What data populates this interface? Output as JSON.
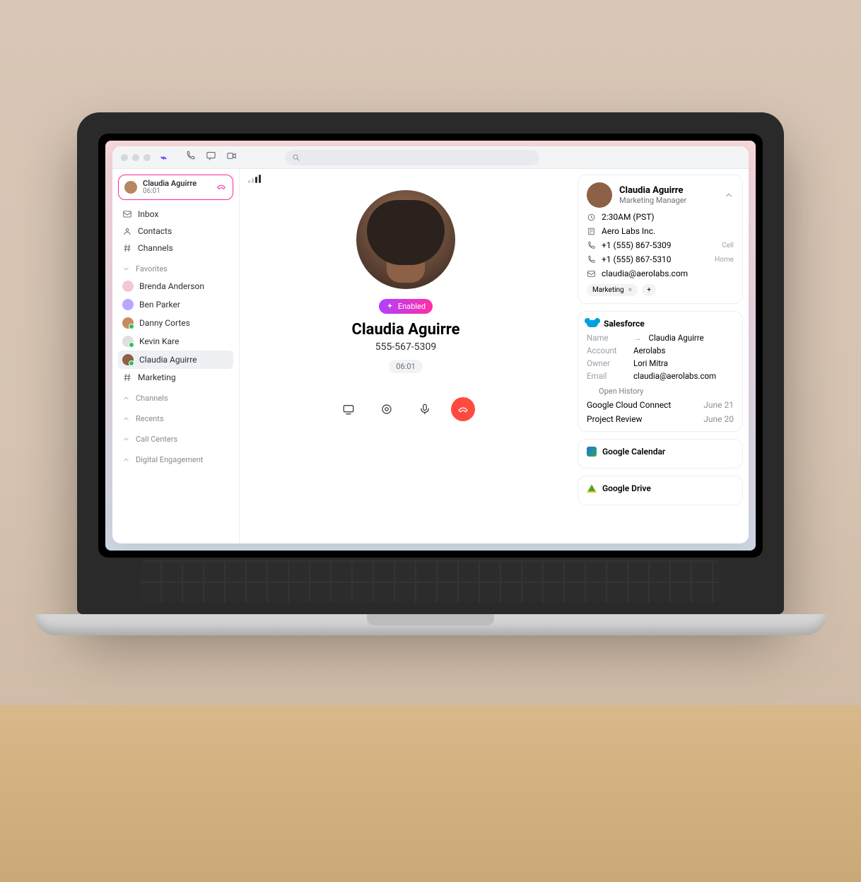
{
  "titlebar": {
    "search_placeholder": ""
  },
  "sidebar": {
    "active_call": {
      "name": "Claudia Aguirre",
      "duration": "06:01"
    },
    "nav": {
      "inbox": "Inbox",
      "contacts": "Contacts",
      "channels": "Channels"
    },
    "groups": {
      "favorites_label": "Favorites",
      "favorites": [
        {
          "name": "Brenda Anderson",
          "color": "#f4c7d3"
        },
        {
          "name": "Ben Parker",
          "color": "#b9a6ff"
        },
        {
          "name": "Danny Cortes",
          "color": "#c98b5e",
          "presence": true
        },
        {
          "name": "Kevin Kare",
          "color": "#dedfe2",
          "presence": true
        },
        {
          "name": "Claudia Aguirre",
          "color": "#8c6145",
          "selected": true,
          "presence": true
        },
        {
          "name": "Marketing",
          "hash": true
        }
      ],
      "channels_label": "Channels",
      "recents_label": "Recents",
      "callcenters_label": "Call Centers",
      "digitaleng_label": "Digital Engagement"
    }
  },
  "call": {
    "pill_label": "Enabled",
    "name": "Claudia Aguirre",
    "phone": "555-567-5309",
    "duration": "06:01"
  },
  "profile": {
    "name": "Claudia Aguirre",
    "role": "Marketing Manager",
    "time": "2:30AM (PST)",
    "company": "Aero Labs Inc.",
    "phones": [
      {
        "number": "+1 (555) 867-5309",
        "type": "Cell"
      },
      {
        "number": "+1 (555) 867-5310",
        "type": "Home"
      }
    ],
    "email": "claudia@aerolabs.com",
    "tag": "Marketing"
  },
  "salesforce": {
    "heading": "Salesforce",
    "name_k": "Name",
    "name_v": "Claudia Aguirre",
    "account_k": "Account",
    "account_v": "Aerolabs",
    "owner_k": "Owner",
    "owner_v": "Lori Mitra",
    "email_k": "Email",
    "email_v": "claudia@aerolabs.com",
    "open_history": "Open History",
    "history": [
      {
        "title": "Google Cloud Connect",
        "date": "June 21"
      },
      {
        "title": "Project Review",
        "date": "June 20"
      }
    ]
  },
  "integrations": {
    "gcal": "Google Calendar",
    "gdrive": "Google Drive"
  }
}
